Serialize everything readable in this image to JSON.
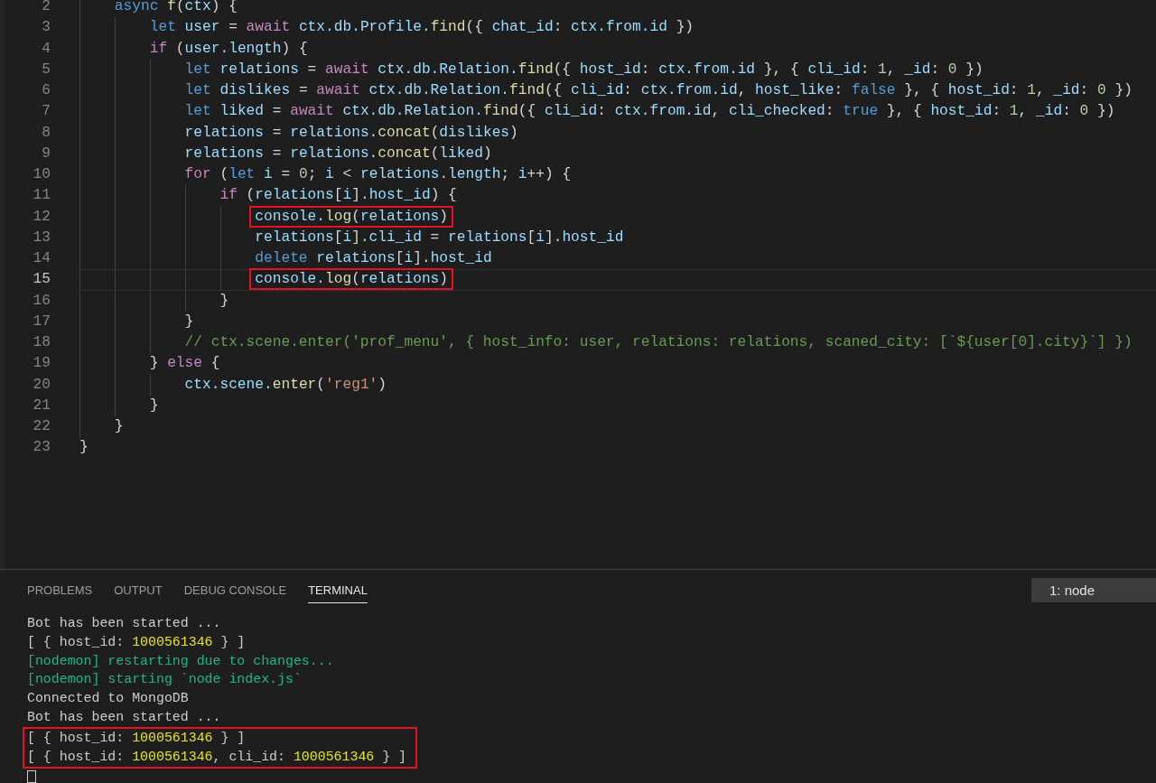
{
  "editor": {
    "lines": [
      {
        "number": "2",
        "current": false,
        "highlighted": false,
        "tokens": [
          {
            "text": "    async",
            "kind": "kw"
          },
          {
            "text": " f",
            "kind": "fn"
          },
          {
            "text": "(",
            "kind": "pun"
          },
          {
            "text": "ctx",
            "kind": "var"
          },
          {
            "text": ") {",
            "kind": "pun"
          }
        ]
      },
      {
        "number": "3",
        "current": false,
        "highlighted": false,
        "tokens": [
          {
            "text": "        let",
            "kind": "kw"
          },
          {
            "text": " user",
            "kind": "var"
          },
          {
            "text": " = ",
            "kind": "pun"
          },
          {
            "text": "await",
            "kind": "ctl"
          },
          {
            "text": " ctx.db.Profile.",
            "kind": "var"
          },
          {
            "text": "find",
            "kind": "fn"
          },
          {
            "text": "({ ",
            "kind": "pun"
          },
          {
            "text": "chat_id",
            "kind": "var"
          },
          {
            "text": ": ",
            "kind": "pun"
          },
          {
            "text": "ctx.from.id",
            "kind": "var"
          },
          {
            "text": " })",
            "kind": "pun"
          }
        ]
      },
      {
        "number": "4",
        "current": false,
        "highlighted": false,
        "tokens": [
          {
            "text": "        if",
            "kind": "ctl"
          },
          {
            "text": " (",
            "kind": "pun"
          },
          {
            "text": "user.length",
            "kind": "var"
          },
          {
            "text": ") {",
            "kind": "pun"
          }
        ]
      },
      {
        "number": "5",
        "current": false,
        "highlighted": false,
        "tokens": [
          {
            "text": "            let",
            "kind": "kw"
          },
          {
            "text": " relations",
            "kind": "var"
          },
          {
            "text": " = ",
            "kind": "pun"
          },
          {
            "text": "await",
            "kind": "ctl"
          },
          {
            "text": " ctx.db.Relation.",
            "kind": "var"
          },
          {
            "text": "find",
            "kind": "fn"
          },
          {
            "text": "({ ",
            "kind": "pun"
          },
          {
            "text": "host_id",
            "kind": "var"
          },
          {
            "text": ": ",
            "kind": "pun"
          },
          {
            "text": "ctx.from.id",
            "kind": "var"
          },
          {
            "text": " }, { ",
            "kind": "pun"
          },
          {
            "text": "cli_id",
            "kind": "var"
          },
          {
            "text": ": ",
            "kind": "pun"
          },
          {
            "text": "1",
            "kind": "num"
          },
          {
            "text": ", ",
            "kind": "pun"
          },
          {
            "text": "_id",
            "kind": "var"
          },
          {
            "text": ": ",
            "kind": "pun"
          },
          {
            "text": "0",
            "kind": "num"
          },
          {
            "text": " })",
            "kind": "pun"
          }
        ]
      },
      {
        "number": "6",
        "current": false,
        "highlighted": false,
        "tokens": [
          {
            "text": "            let",
            "kind": "kw"
          },
          {
            "text": " dislikes",
            "kind": "var"
          },
          {
            "text": " = ",
            "kind": "pun"
          },
          {
            "text": "await",
            "kind": "ctl"
          },
          {
            "text": " ctx.db.Relation.",
            "kind": "var"
          },
          {
            "text": "find",
            "kind": "fn"
          },
          {
            "text": "({ ",
            "kind": "pun"
          },
          {
            "text": "cli_id",
            "kind": "var"
          },
          {
            "text": ": ",
            "kind": "pun"
          },
          {
            "text": "ctx.from.id",
            "kind": "var"
          },
          {
            "text": ", ",
            "kind": "pun"
          },
          {
            "text": "host_like",
            "kind": "var"
          },
          {
            "text": ": ",
            "kind": "pun"
          },
          {
            "text": "false",
            "kind": "kw"
          },
          {
            "text": " }, { ",
            "kind": "pun"
          },
          {
            "text": "host_id",
            "kind": "var"
          },
          {
            "text": ": ",
            "kind": "pun"
          },
          {
            "text": "1",
            "kind": "num"
          },
          {
            "text": ", ",
            "kind": "pun"
          },
          {
            "text": "_id",
            "kind": "var"
          },
          {
            "text": ": ",
            "kind": "pun"
          },
          {
            "text": "0",
            "kind": "num"
          },
          {
            "text": " })",
            "kind": "pun"
          }
        ]
      },
      {
        "number": "7",
        "current": false,
        "highlighted": false,
        "tokens": [
          {
            "text": "            let",
            "kind": "kw"
          },
          {
            "text": " liked",
            "kind": "var"
          },
          {
            "text": " = ",
            "kind": "pun"
          },
          {
            "text": "await",
            "kind": "ctl"
          },
          {
            "text": " ctx.db.Relation.",
            "kind": "var"
          },
          {
            "text": "find",
            "kind": "fn"
          },
          {
            "text": "({ ",
            "kind": "pun"
          },
          {
            "text": "cli_id",
            "kind": "var"
          },
          {
            "text": ": ",
            "kind": "pun"
          },
          {
            "text": "ctx.from.id",
            "kind": "var"
          },
          {
            "text": ", ",
            "kind": "pun"
          },
          {
            "text": "cli_checked",
            "kind": "var"
          },
          {
            "text": ": ",
            "kind": "pun"
          },
          {
            "text": "true",
            "kind": "kw"
          },
          {
            "text": " }, { ",
            "kind": "pun"
          },
          {
            "text": "host_id",
            "kind": "var"
          },
          {
            "text": ": ",
            "kind": "pun"
          },
          {
            "text": "1",
            "kind": "num"
          },
          {
            "text": ", ",
            "kind": "pun"
          },
          {
            "text": "_id",
            "kind": "var"
          },
          {
            "text": ": ",
            "kind": "pun"
          },
          {
            "text": "0",
            "kind": "num"
          },
          {
            "text": " })",
            "kind": "pun"
          }
        ]
      },
      {
        "number": "8",
        "current": false,
        "highlighted": false,
        "tokens": [
          {
            "text": "            relations",
            "kind": "var"
          },
          {
            "text": " = ",
            "kind": "pun"
          },
          {
            "text": "relations.",
            "kind": "var"
          },
          {
            "text": "concat",
            "kind": "fn"
          },
          {
            "text": "(",
            "kind": "pun"
          },
          {
            "text": "dislikes",
            "kind": "var"
          },
          {
            "text": ")",
            "kind": "pun"
          }
        ]
      },
      {
        "number": "9",
        "current": false,
        "highlighted": false,
        "tokens": [
          {
            "text": "            relations",
            "kind": "var"
          },
          {
            "text": " = ",
            "kind": "pun"
          },
          {
            "text": "relations.",
            "kind": "var"
          },
          {
            "text": "concat",
            "kind": "fn"
          },
          {
            "text": "(",
            "kind": "pun"
          },
          {
            "text": "liked",
            "kind": "var"
          },
          {
            "text": ")",
            "kind": "pun"
          }
        ]
      },
      {
        "number": "10",
        "current": false,
        "highlighted": false,
        "tokens": [
          {
            "text": "            for",
            "kind": "ctl"
          },
          {
            "text": " (",
            "kind": "pun"
          },
          {
            "text": "let",
            "kind": "kw"
          },
          {
            "text": " i",
            "kind": "var"
          },
          {
            "text": " = ",
            "kind": "pun"
          },
          {
            "text": "0",
            "kind": "num"
          },
          {
            "text": "; ",
            "kind": "pun"
          },
          {
            "text": "i",
            "kind": "var"
          },
          {
            "text": " < ",
            "kind": "pun"
          },
          {
            "text": "relations.length",
            "kind": "var"
          },
          {
            "text": "; ",
            "kind": "pun"
          },
          {
            "text": "i",
            "kind": "var"
          },
          {
            "text": "++) {",
            "kind": "pun"
          }
        ]
      },
      {
        "number": "11",
        "current": false,
        "highlighted": false,
        "tokens": [
          {
            "text": "                if",
            "kind": "ctl"
          },
          {
            "text": " (",
            "kind": "pun"
          },
          {
            "text": "relations",
            "kind": "var"
          },
          {
            "text": "[",
            "kind": "pun"
          },
          {
            "text": "i",
            "kind": "var"
          },
          {
            "text": "].",
            "kind": "pun"
          },
          {
            "text": "host_id",
            "kind": "var"
          },
          {
            "text": ") {",
            "kind": "pun"
          }
        ]
      },
      {
        "number": "12",
        "current": false,
        "highlighted": true,
        "tokens": [
          {
            "text": "                    console.",
            "kind": "var"
          },
          {
            "text": "log",
            "kind": "fn"
          },
          {
            "text": "(",
            "kind": "pun"
          },
          {
            "text": "relations",
            "kind": "var"
          },
          {
            "text": ")",
            "kind": "pun"
          }
        ]
      },
      {
        "number": "13",
        "current": false,
        "highlighted": false,
        "tokens": [
          {
            "text": "                    relations",
            "kind": "var"
          },
          {
            "text": "[",
            "kind": "pun"
          },
          {
            "text": "i",
            "kind": "var"
          },
          {
            "text": "].",
            "kind": "pun"
          },
          {
            "text": "cli_id",
            "kind": "var"
          },
          {
            "text": " = ",
            "kind": "pun"
          },
          {
            "text": "relations",
            "kind": "var"
          },
          {
            "text": "[",
            "kind": "pun"
          },
          {
            "text": "i",
            "kind": "var"
          },
          {
            "text": "].",
            "kind": "pun"
          },
          {
            "text": "host_id",
            "kind": "var"
          }
        ]
      },
      {
        "number": "14",
        "current": false,
        "highlighted": false,
        "tokens": [
          {
            "text": "                    delete",
            "kind": "kw"
          },
          {
            "text": " relations",
            "kind": "var"
          },
          {
            "text": "[",
            "kind": "pun"
          },
          {
            "text": "i",
            "kind": "var"
          },
          {
            "text": "].",
            "kind": "pun"
          },
          {
            "text": "host_id",
            "kind": "var"
          }
        ]
      },
      {
        "number": "15",
        "current": true,
        "highlighted": true,
        "tokens": [
          {
            "text": "                    console.",
            "kind": "var"
          },
          {
            "text": "log",
            "kind": "fn"
          },
          {
            "text": "(",
            "kind": "pun"
          },
          {
            "text": "relations",
            "kind": "var"
          },
          {
            "text": ")",
            "kind": "pun"
          }
        ]
      },
      {
        "number": "16",
        "current": false,
        "highlighted": false,
        "tokens": [
          {
            "text": "                }",
            "kind": "pun"
          }
        ]
      },
      {
        "number": "17",
        "current": false,
        "highlighted": false,
        "tokens": [
          {
            "text": "            }",
            "kind": "pun"
          }
        ]
      },
      {
        "number": "18",
        "current": false,
        "highlighted": false,
        "tokens": [
          {
            "text": "            // ctx.scene.enter('prof_menu', { host_info: user, relations: relations, scaned_city: [`${user[0].city}`] })",
            "kind": "com"
          }
        ]
      },
      {
        "number": "19",
        "current": false,
        "highlighted": false,
        "tokens": [
          {
            "text": "        } ",
            "kind": "pun"
          },
          {
            "text": "else",
            "kind": "ctl"
          },
          {
            "text": " {",
            "kind": "pun"
          }
        ]
      },
      {
        "number": "20",
        "current": false,
        "highlighted": false,
        "tokens": [
          {
            "text": "            ctx.scene.",
            "kind": "var"
          },
          {
            "text": "enter",
            "kind": "fn"
          },
          {
            "text": "(",
            "kind": "pun"
          },
          {
            "text": "'reg1'",
            "kind": "str"
          },
          {
            "text": ")",
            "kind": "pun"
          }
        ]
      },
      {
        "number": "21",
        "current": false,
        "highlighted": false,
        "tokens": [
          {
            "text": "        }",
            "kind": "pun"
          }
        ]
      },
      {
        "number": "22",
        "current": false,
        "highlighted": false,
        "tokens": [
          {
            "text": "    }",
            "kind": "pun"
          }
        ]
      },
      {
        "number": "23",
        "current": false,
        "highlighted": false,
        "tokens": [
          {
            "text": "}",
            "kind": "pun"
          }
        ]
      }
    ]
  },
  "panel": {
    "tabs": [
      {
        "label": "PROBLEMS",
        "selected": false
      },
      {
        "label": "OUTPUT",
        "selected": false
      },
      {
        "label": "DEBUG CONSOLE",
        "selected": false
      },
      {
        "label": "TERMINAL",
        "selected": true
      }
    ],
    "terminal_select": "1: node",
    "terminal_lines": [
      {
        "highlighted": false,
        "tokens": [
          {
            "text": "Bot has been started ...",
            "kind": "plain"
          }
        ]
      },
      {
        "highlighted": false,
        "tokens": [
          {
            "text": "[ { host_id: ",
            "kind": "plain"
          },
          {
            "text": "1000561346",
            "kind": "num"
          },
          {
            "text": " } ]",
            "kind": "plain"
          }
        ]
      },
      {
        "highlighted": false,
        "tokens": [
          {
            "text": "[nodemon] restarting due to changes...",
            "kind": "green"
          }
        ]
      },
      {
        "highlighted": false,
        "tokens": [
          {
            "text": "[nodemon] starting `node index.js`",
            "kind": "green"
          }
        ]
      },
      {
        "highlighted": false,
        "tokens": [
          {
            "text": "Connected to MongoDB",
            "kind": "plain"
          }
        ]
      },
      {
        "highlighted": false,
        "tokens": [
          {
            "text": "Bot has been started ...",
            "kind": "plain"
          }
        ]
      },
      {
        "highlighted": true,
        "tokens": [
          {
            "text": "[ { host_id: ",
            "kind": "plain"
          },
          {
            "text": "1000561346",
            "kind": "num"
          },
          {
            "text": " } ]",
            "kind": "plain"
          }
        ]
      },
      {
        "highlighted": true,
        "tokens": [
          {
            "text": "[ { host_id: ",
            "kind": "plain"
          },
          {
            "text": "1000561346",
            "kind": "num"
          },
          {
            "text": ", cli_id: ",
            "kind": "plain"
          },
          {
            "text": "1000561346",
            "kind": "num"
          },
          {
            "text": " } ]",
            "kind": "plain"
          }
        ]
      }
    ]
  }
}
